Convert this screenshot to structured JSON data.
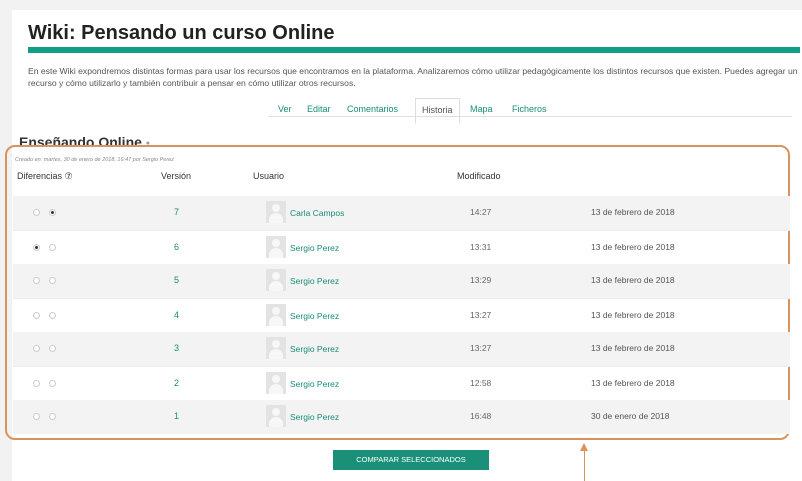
{
  "page": {
    "title": "Wiki: Pensando un curso Online",
    "intro": "En este Wiki expondremos distintas formas para usar los recursos que encontramos en la plataforma. Analizaremos cómo utilizar pedagógicamente los distintos recursos que existen. Puedes agregar un recurso y cómo utilizarlo y también contribuir a pensar en cómo utilizar otros recursos."
  },
  "tabs": [
    {
      "label": "Ver"
    },
    {
      "label": "Editar"
    },
    {
      "label": "Comentarios"
    },
    {
      "label": "Historia"
    },
    {
      "label": "Mapa"
    },
    {
      "label": "Ficheros"
    }
  ],
  "section": {
    "title": "Enseñando Online",
    "created": "Creado en: martes, 30 de enero de 2018, 16:47 por Sergio Perez"
  },
  "table": {
    "headers": {
      "diff": "Diferencias ⑦",
      "version": "Versión",
      "user": "Usuario",
      "modified": "Modificado"
    },
    "rows": [
      {
        "version": "7",
        "user": "Carla Campos",
        "time": "14:27",
        "date": "13 de febrero de 2018",
        "radio1": false,
        "radio2": true
      },
      {
        "version": "6",
        "user": "Sergio Perez",
        "time": "13:31",
        "date": "13 de febrero de 2018",
        "radio1": true,
        "radio2": false
      },
      {
        "version": "5",
        "user": "Sergio Perez",
        "time": "13:29",
        "date": "13 de febrero de 2018",
        "radio1": false,
        "radio2": false
      },
      {
        "version": "4",
        "user": "Sergio Perez",
        "time": "13:27",
        "date": "13 de febrero de 2018",
        "radio1": false,
        "radio2": false
      },
      {
        "version": "3",
        "user": "Sergio Perez",
        "time": "13:27",
        "date": "13 de febrero de 2018",
        "radio1": false,
        "radio2": false
      },
      {
        "version": "2",
        "user": "Sergio Perez",
        "time": "12:58",
        "date": "13 de febrero de 2018",
        "radio1": false,
        "radio2": false
      },
      {
        "version": "1",
        "user": "Sergio Perez",
        "time": "16:48",
        "date": "30 de enero de 2018",
        "radio1": false,
        "radio2": false
      }
    ]
  },
  "actions": {
    "compare_label": "COMPARAR SELECCIONADOS"
  },
  "colors": {
    "accent": "#109f84",
    "link": "#168d77",
    "highlight": "#d9935f"
  }
}
